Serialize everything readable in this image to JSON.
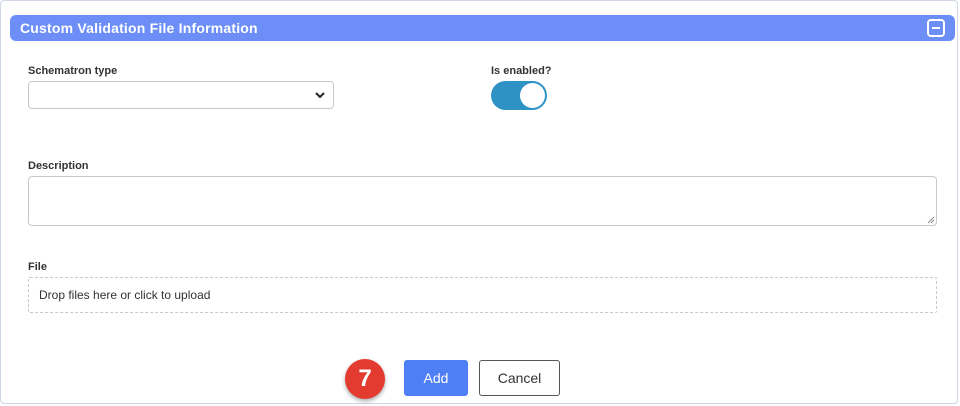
{
  "panel": {
    "title": "Custom Validation File Information",
    "header_color": "#6d8ef7",
    "collapse_icon": "minus-square-icon"
  },
  "form": {
    "schematron_type": {
      "label": "Schematron type",
      "value": ""
    },
    "is_enabled": {
      "label": "Is enabled?",
      "value": true,
      "color": "#2e93c4"
    },
    "description": {
      "label": "Description",
      "value": ""
    },
    "file": {
      "label": "File",
      "dropzone_text": "Drop files here or click to upload"
    }
  },
  "annotation": {
    "step_number": "7",
    "color": "#e33b2f"
  },
  "actions": {
    "add_label": "Add",
    "cancel_label": "Cancel",
    "primary_color": "#4f7ff5"
  }
}
